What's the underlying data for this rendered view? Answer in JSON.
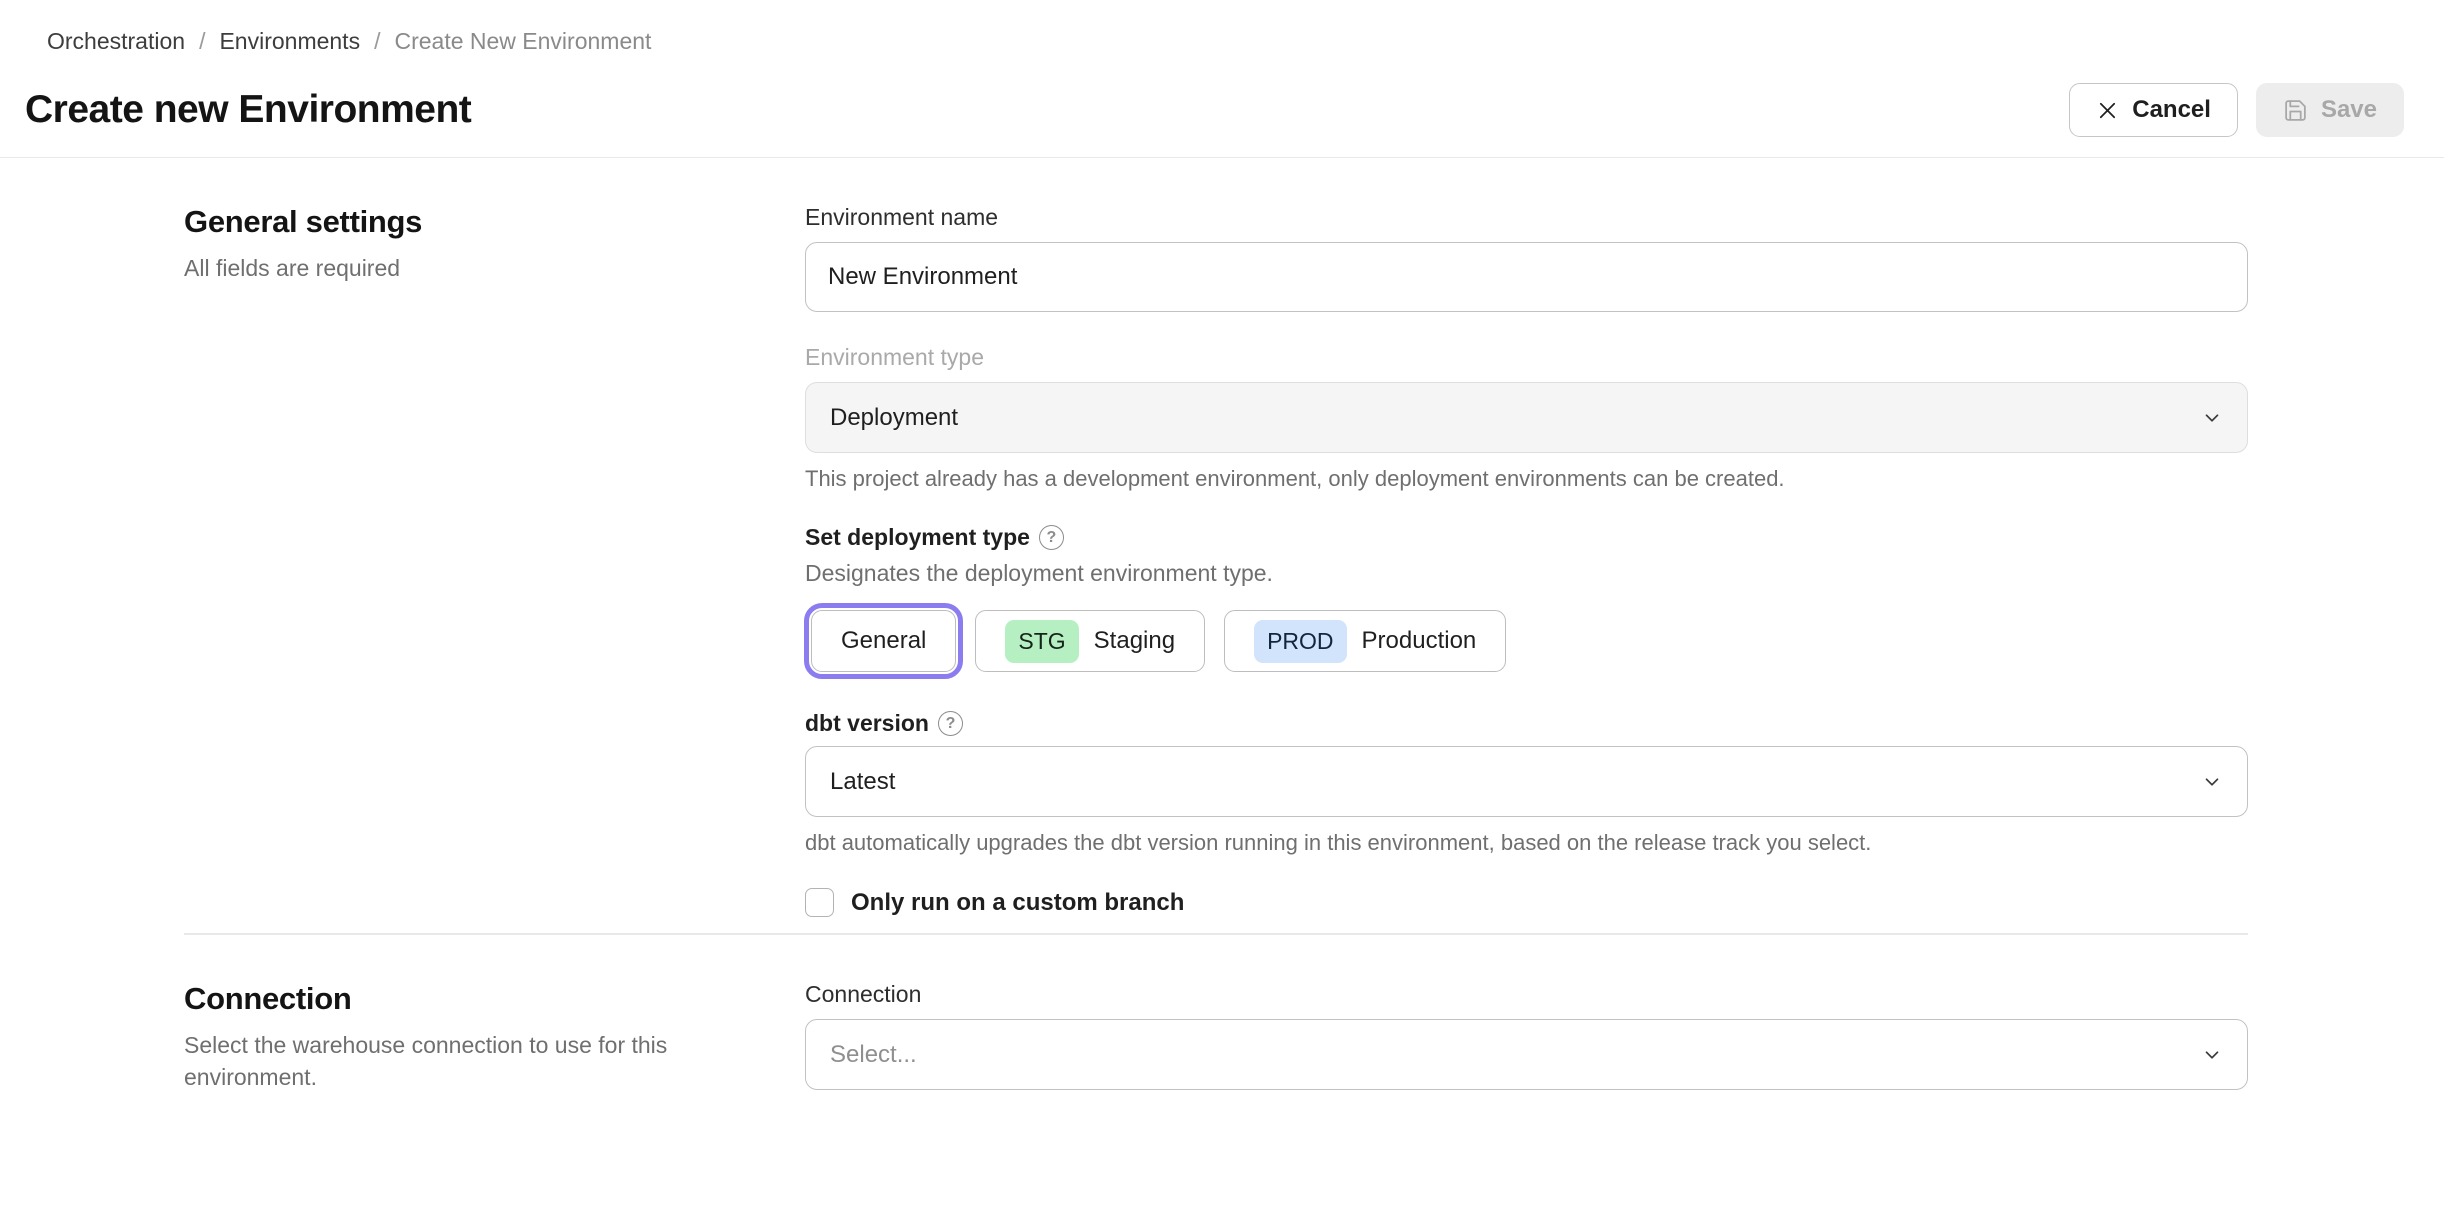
{
  "breadcrumb": {
    "separator": "/",
    "items": [
      "Orchestration",
      "Environments",
      "Create New Environment"
    ]
  },
  "header": {
    "title": "Create new Environment",
    "cancel_label": "Cancel",
    "save_label": "Save"
  },
  "icons": {
    "help_glyph": "?",
    "cancel": "x-icon",
    "save": "floppy-disk-icon",
    "dropdown": "chevron-down-icon"
  },
  "general": {
    "heading": "General settings",
    "subheading": "All fields are required",
    "environment_name": {
      "label": "Environment name",
      "value": "New Environment"
    },
    "environment_type": {
      "label": "Environment type",
      "value": "Deployment",
      "helper": "This project already has a development environment, only deployment environments can be created."
    },
    "deployment_type": {
      "label": "Set deployment type",
      "description": "Designates the deployment environment type.",
      "options": [
        {
          "label": "General",
          "selected": true
        },
        {
          "label": "Staging",
          "badge": "STG",
          "selected": false
        },
        {
          "label": "Production",
          "badge": "PROD",
          "selected": false
        }
      ]
    },
    "dbt_version": {
      "label": "dbt version",
      "value": "Latest",
      "helper": "dbt automatically upgrades the dbt version running in this environment, based on the release track you select."
    },
    "custom_branch": {
      "label": "Only run on a custom branch",
      "checked": false
    }
  },
  "connection": {
    "heading": "Connection",
    "description": "Select the warehouse connection to use for this environment.",
    "field_label": "Connection",
    "placeholder": "Select..."
  },
  "colors": {
    "accent_purple": "#8b7cf0",
    "staging_badge_bg": "#b6f0c2",
    "production_badge_bg": "#d2e3fc",
    "divider": "#e9e9e9",
    "disabled_field_bg": "#f5f5f5"
  }
}
